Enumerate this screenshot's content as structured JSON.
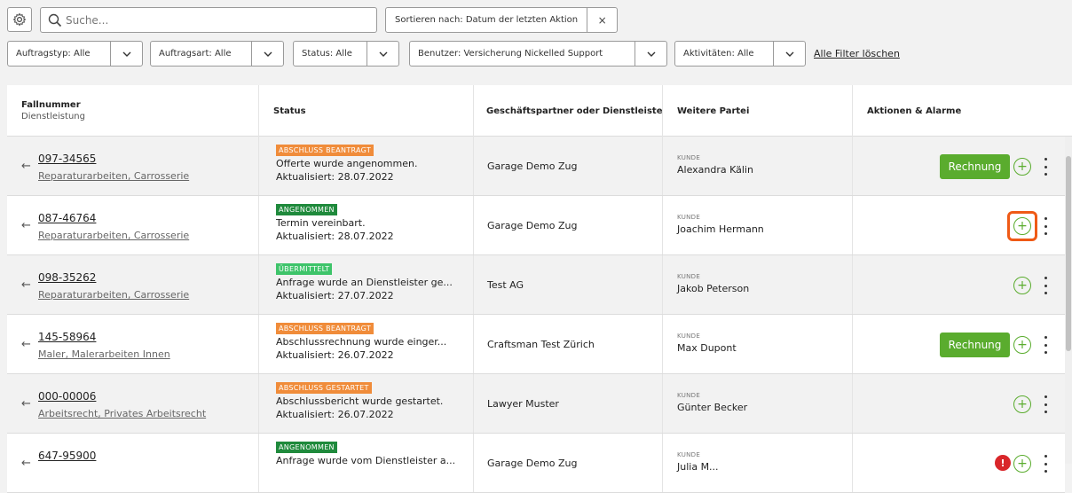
{
  "toolbar": {
    "search_placeholder": "Suche...",
    "sort_label": "Sortieren nach: Datum der letzten Aktion",
    "sort_clear": "×",
    "filters": {
      "auftragstyp": "Auftragstyp: Alle",
      "auftragsart": "Auftragsart: Alle",
      "status": "Status: Alle",
      "benutzer": "Benutzer: Versicherung Nickelled Support",
      "aktivitaeten": "Aktivitäten: Alle"
    },
    "clear_filters": "Alle Filter löschen"
  },
  "table": {
    "headers": {
      "case": "Fallnummer",
      "case_sub": "Dienstleistung",
      "status": "Status",
      "partner": "Geschäftspartner oder Dienstleiste...",
      "party": "Weitere Partei",
      "actions": "Aktionen & Alarme"
    },
    "rows": [
      {
        "arrow": "←",
        "case": "097-34565",
        "service": "Reparaturarbeiten, Carrosserie",
        "badge": "ABSCHLUSS BEANTRAGT",
        "badge_color": "#f08c3a",
        "status": "Offerte wurde angenommen.",
        "updated": "Aktualisiert: 28.07.2022",
        "partner": "Garage Demo Zug",
        "role": "KUNDE",
        "person": "Alexandra Kälin",
        "invoice": "Rechnung",
        "plus": "+"
      },
      {
        "arrow": "←",
        "case": "087-46764",
        "service": "Reparaturarbeiten, Carrosserie",
        "badge": "ANGENOMMEN",
        "badge_color": "#1f8a3c",
        "status": "Termin vereinbart.",
        "updated": "Aktualisiert: 28.07.2022",
        "partner": "Garage Demo Zug",
        "role": "KUNDE",
        "person": "Joachim Hermann",
        "plus": "+"
      },
      {
        "arrow": "←",
        "case": "098-35262",
        "service": "Reparaturarbeiten, Carrosserie",
        "badge": "ÜBERMITTELT",
        "badge_color": "#3ec46a",
        "status": "Anfrage wurde an Dienstleister ge...",
        "updated": "Aktualisiert: 27.07.2022",
        "partner": "Test AG",
        "role": "KUNDE",
        "person": "Jakob Peterson",
        "plus": "+"
      },
      {
        "arrow": "←",
        "case": "145-58964",
        "service": "Maler, Malerarbeiten Innen",
        "badge": "ABSCHLUSS BEANTRAGT",
        "badge_color": "#f08c3a",
        "status": "Abschlussrechnung wurde einger...",
        "updated": "Aktualisiert: 26.07.2022",
        "partner": "Craftsman Test Zürich",
        "role": "KUNDE",
        "person": "Max Dupont",
        "invoice": "Rechnung",
        "plus": "+"
      },
      {
        "arrow": "←",
        "case": "000-00006",
        "service": "Arbeitsrecht, Privates Arbeitsrecht",
        "badge": "ABSCHLUSS GESTARTET",
        "badge_color": "#f08c3a",
        "status": "Abschlussbericht wurde gestartet.",
        "updated": "Aktualisiert: 26.07.2022",
        "partner": "Lawyer Muster",
        "role": "KUNDE",
        "person": "Günter Becker",
        "plus": "+"
      },
      {
        "arrow": "←",
        "case": "647-95900",
        "service": "",
        "badge": "ANGENOMMEN",
        "badge_color": "#1f8a3c",
        "status": "Anfrage wurde vom Dienstleister a...",
        "updated": "",
        "partner": "Garage Demo Zug",
        "role": "KUNDE",
        "person": "Julia M...",
        "alert": "!",
        "plus": "+"
      }
    ]
  }
}
